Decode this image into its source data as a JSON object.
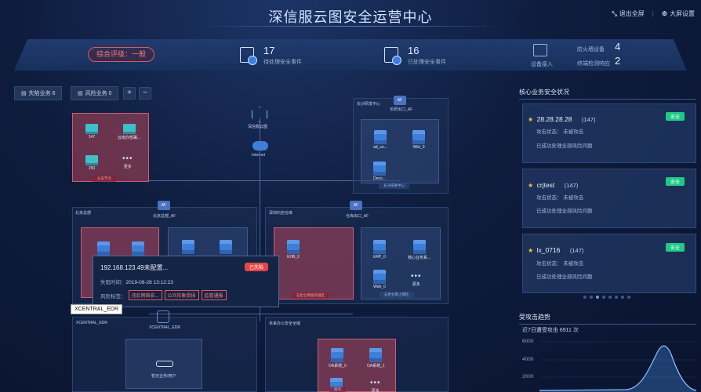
{
  "header": {
    "title": "深信服云图安全运营中心",
    "exit_fullscreen": "退出全屏",
    "screen_settings": "大屏设置"
  },
  "stats": {
    "rating": "综合评级：一般",
    "pending_events": {
      "value": "17",
      "label": "待处理安全事件"
    },
    "handled_events": {
      "value": "16",
      "label": "已处理安全事件"
    },
    "device_access_label": "设备接入",
    "firewall": {
      "label": "防火墙设备",
      "value": "4"
    },
    "endpoint": {
      "label": "终端检测响应",
      "value": "2"
    }
  },
  "toolbar": {
    "lost_business": "失陷业务 6",
    "risk_business": "风险业务 0",
    "zoom_in": "+",
    "zoom_out": "−"
  },
  "topology": {
    "cloud_center": "深信服云图",
    "internet": "Internet",
    "cs_group": "长沙研发中心",
    "cs_exit": "长研出口_AF",
    "cs_servers": [
      "ad_co...",
      "Wiki_0",
      "Devo..."
    ],
    "cs_zone": "长沙研发中心",
    "tl_zone_nodes": [
      "147",
      "云南办部署...",
      "250",
      "更多"
    ],
    "tl_zone": "分支节点",
    "bj_group": "北京总部",
    "bj_exit": "北京总部_AF",
    "sz_group": "深圳石岩仓库",
    "sz_exit": "仓库出口_AF",
    "sz_red_node": "EHB_0",
    "sz_red_zone": "石岩仓库服务器区",
    "sz_blue_nodes": [
      "ERP_0",
      "核心业务系...",
      "Web_0",
      "更多"
    ],
    "sz_blue_zone": "石岩仓库上网区",
    "edr_label": "XCENTRAL_EDR",
    "edr_group": "XCENTRAL_EDR",
    "edr_sub": "暂无业务/用户",
    "oa_group": "未来办公安全全域",
    "oa_nodes": [
      "OA系统_0",
      "OA系统_1",
      "更多"
    ],
    "oa_zone": "服务"
  },
  "popup": {
    "ip": "192.168.123.49未配置...",
    "status": "已失陷",
    "lost_time_label": "失陷时间：",
    "lost_time": "2019-08-28 13:12:23",
    "risk_label": "风险标签：",
    "risks": [
      "违反网络安...",
      "公众形象受损",
      "监管通报"
    ]
  },
  "tooltip": "XCENTRAL_EDR",
  "core": {
    "title": "核心业务安全状况",
    "cards": [
      {
        "name": "28.28.28.28",
        "count": "(147)",
        "badge": "安全",
        "attack": "攻击状态：  未被攻击",
        "risk": "已成功处理全部风险问题"
      },
      {
        "name": "crjtest",
        "count": "(147)",
        "badge": "安全",
        "attack": "攻击状态：  未被攻击",
        "risk": "已成功处理全部风险问题"
      },
      {
        "name": "lx_0716",
        "count": "(147)",
        "badge": "安全",
        "attack": "攻击状态：  未被攻击",
        "risk": "已成功处理全部风险问题"
      }
    ]
  },
  "trend": {
    "title": "受攻击趋势",
    "subtitle": "近7日遭受攻击 6911 次",
    "y_ticks": [
      "6000",
      "4000",
      "2000"
    ]
  },
  "colors": {
    "accent": "#3b7fe0",
    "danger": "#e64545",
    "safe": "#1ec987"
  }
}
